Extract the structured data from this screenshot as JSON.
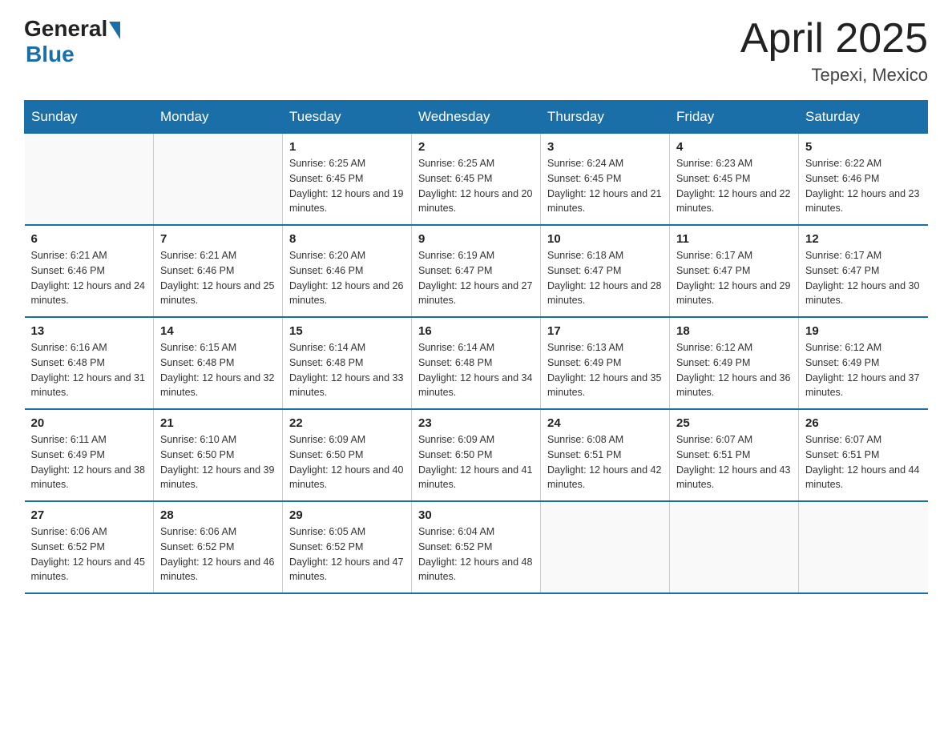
{
  "header": {
    "logo_general": "General",
    "logo_blue": "Blue",
    "month_year": "April 2025",
    "location": "Tepexi, Mexico"
  },
  "days_of_week": [
    "Sunday",
    "Monday",
    "Tuesday",
    "Wednesday",
    "Thursday",
    "Friday",
    "Saturday"
  ],
  "weeks": [
    [
      {
        "day": "",
        "sunrise": "",
        "sunset": "",
        "daylight": ""
      },
      {
        "day": "",
        "sunrise": "",
        "sunset": "",
        "daylight": ""
      },
      {
        "day": "1",
        "sunrise": "Sunrise: 6:25 AM",
        "sunset": "Sunset: 6:45 PM",
        "daylight": "Daylight: 12 hours and 19 minutes."
      },
      {
        "day": "2",
        "sunrise": "Sunrise: 6:25 AM",
        "sunset": "Sunset: 6:45 PM",
        "daylight": "Daylight: 12 hours and 20 minutes."
      },
      {
        "day": "3",
        "sunrise": "Sunrise: 6:24 AM",
        "sunset": "Sunset: 6:45 PM",
        "daylight": "Daylight: 12 hours and 21 minutes."
      },
      {
        "day": "4",
        "sunrise": "Sunrise: 6:23 AM",
        "sunset": "Sunset: 6:45 PM",
        "daylight": "Daylight: 12 hours and 22 minutes."
      },
      {
        "day": "5",
        "sunrise": "Sunrise: 6:22 AM",
        "sunset": "Sunset: 6:46 PM",
        "daylight": "Daylight: 12 hours and 23 minutes."
      }
    ],
    [
      {
        "day": "6",
        "sunrise": "Sunrise: 6:21 AM",
        "sunset": "Sunset: 6:46 PM",
        "daylight": "Daylight: 12 hours and 24 minutes."
      },
      {
        "day": "7",
        "sunrise": "Sunrise: 6:21 AM",
        "sunset": "Sunset: 6:46 PM",
        "daylight": "Daylight: 12 hours and 25 minutes."
      },
      {
        "day": "8",
        "sunrise": "Sunrise: 6:20 AM",
        "sunset": "Sunset: 6:46 PM",
        "daylight": "Daylight: 12 hours and 26 minutes."
      },
      {
        "day": "9",
        "sunrise": "Sunrise: 6:19 AM",
        "sunset": "Sunset: 6:47 PM",
        "daylight": "Daylight: 12 hours and 27 minutes."
      },
      {
        "day": "10",
        "sunrise": "Sunrise: 6:18 AM",
        "sunset": "Sunset: 6:47 PM",
        "daylight": "Daylight: 12 hours and 28 minutes."
      },
      {
        "day": "11",
        "sunrise": "Sunrise: 6:17 AM",
        "sunset": "Sunset: 6:47 PM",
        "daylight": "Daylight: 12 hours and 29 minutes."
      },
      {
        "day": "12",
        "sunrise": "Sunrise: 6:17 AM",
        "sunset": "Sunset: 6:47 PM",
        "daylight": "Daylight: 12 hours and 30 minutes."
      }
    ],
    [
      {
        "day": "13",
        "sunrise": "Sunrise: 6:16 AM",
        "sunset": "Sunset: 6:48 PM",
        "daylight": "Daylight: 12 hours and 31 minutes."
      },
      {
        "day": "14",
        "sunrise": "Sunrise: 6:15 AM",
        "sunset": "Sunset: 6:48 PM",
        "daylight": "Daylight: 12 hours and 32 minutes."
      },
      {
        "day": "15",
        "sunrise": "Sunrise: 6:14 AM",
        "sunset": "Sunset: 6:48 PM",
        "daylight": "Daylight: 12 hours and 33 minutes."
      },
      {
        "day": "16",
        "sunrise": "Sunrise: 6:14 AM",
        "sunset": "Sunset: 6:48 PM",
        "daylight": "Daylight: 12 hours and 34 minutes."
      },
      {
        "day": "17",
        "sunrise": "Sunrise: 6:13 AM",
        "sunset": "Sunset: 6:49 PM",
        "daylight": "Daylight: 12 hours and 35 minutes."
      },
      {
        "day": "18",
        "sunrise": "Sunrise: 6:12 AM",
        "sunset": "Sunset: 6:49 PM",
        "daylight": "Daylight: 12 hours and 36 minutes."
      },
      {
        "day": "19",
        "sunrise": "Sunrise: 6:12 AM",
        "sunset": "Sunset: 6:49 PM",
        "daylight": "Daylight: 12 hours and 37 minutes."
      }
    ],
    [
      {
        "day": "20",
        "sunrise": "Sunrise: 6:11 AM",
        "sunset": "Sunset: 6:49 PM",
        "daylight": "Daylight: 12 hours and 38 minutes."
      },
      {
        "day": "21",
        "sunrise": "Sunrise: 6:10 AM",
        "sunset": "Sunset: 6:50 PM",
        "daylight": "Daylight: 12 hours and 39 minutes."
      },
      {
        "day": "22",
        "sunrise": "Sunrise: 6:09 AM",
        "sunset": "Sunset: 6:50 PM",
        "daylight": "Daylight: 12 hours and 40 minutes."
      },
      {
        "day": "23",
        "sunrise": "Sunrise: 6:09 AM",
        "sunset": "Sunset: 6:50 PM",
        "daylight": "Daylight: 12 hours and 41 minutes."
      },
      {
        "day": "24",
        "sunrise": "Sunrise: 6:08 AM",
        "sunset": "Sunset: 6:51 PM",
        "daylight": "Daylight: 12 hours and 42 minutes."
      },
      {
        "day": "25",
        "sunrise": "Sunrise: 6:07 AM",
        "sunset": "Sunset: 6:51 PM",
        "daylight": "Daylight: 12 hours and 43 minutes."
      },
      {
        "day": "26",
        "sunrise": "Sunrise: 6:07 AM",
        "sunset": "Sunset: 6:51 PM",
        "daylight": "Daylight: 12 hours and 44 minutes."
      }
    ],
    [
      {
        "day": "27",
        "sunrise": "Sunrise: 6:06 AM",
        "sunset": "Sunset: 6:52 PM",
        "daylight": "Daylight: 12 hours and 45 minutes."
      },
      {
        "day": "28",
        "sunrise": "Sunrise: 6:06 AM",
        "sunset": "Sunset: 6:52 PM",
        "daylight": "Daylight: 12 hours and 46 minutes."
      },
      {
        "day": "29",
        "sunrise": "Sunrise: 6:05 AM",
        "sunset": "Sunset: 6:52 PM",
        "daylight": "Daylight: 12 hours and 47 minutes."
      },
      {
        "day": "30",
        "sunrise": "Sunrise: 6:04 AM",
        "sunset": "Sunset: 6:52 PM",
        "daylight": "Daylight: 12 hours and 48 minutes."
      },
      {
        "day": "",
        "sunrise": "",
        "sunset": "",
        "daylight": ""
      },
      {
        "day": "",
        "sunrise": "",
        "sunset": "",
        "daylight": ""
      },
      {
        "day": "",
        "sunrise": "",
        "sunset": "",
        "daylight": ""
      }
    ]
  ]
}
